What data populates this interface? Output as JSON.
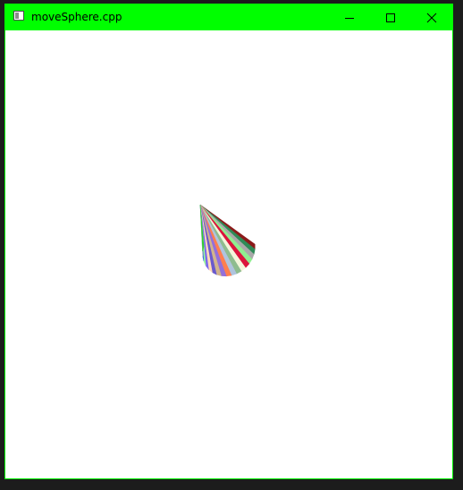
{
  "window": {
    "title": "moveSphere.cpp",
    "titlebar_color": "#00ff00",
    "border_color": "#00ff00",
    "background": "#ffffff"
  },
  "controls": {
    "minimize_icon": "minimize-icon",
    "maximize_icon": "maximize-icon",
    "close_icon": "close-icon"
  },
  "scene": {
    "object": "cone",
    "stripe_colors": [
      "#8b1a1a",
      "#2e8b57",
      "#a9a9a9",
      "#90ee90",
      "#dc143c",
      "#f5f5dc",
      "#8fbc8f",
      "#b0c4de",
      "#ff7f50",
      "#9370db",
      "#d2b48c",
      "#6a5acd",
      "#ffdab9",
      "#7b68ee",
      "#98fb98",
      "#4169e1",
      "#c0c0c0",
      "#32cd32"
    ]
  }
}
